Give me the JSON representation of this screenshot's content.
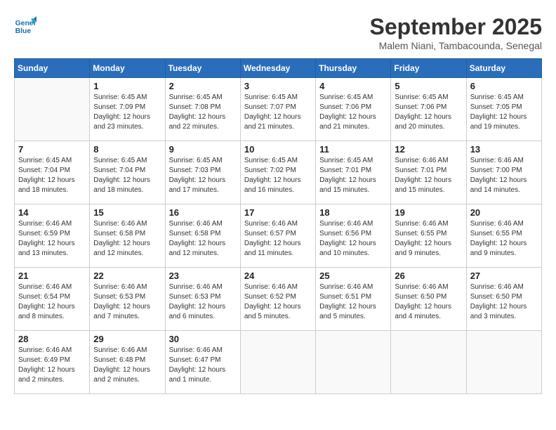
{
  "logo": {
    "line1": "General",
    "line2": "Blue"
  },
  "title": "September 2025",
  "location": "Malem Niani, Tambacounda, Senegal",
  "weekdays": [
    "Sunday",
    "Monday",
    "Tuesday",
    "Wednesday",
    "Thursday",
    "Friday",
    "Saturday"
  ],
  "weeks": [
    [
      {
        "day": "",
        "info": ""
      },
      {
        "day": "1",
        "info": "Sunrise: 6:45 AM\nSunset: 7:09 PM\nDaylight: 12 hours\nand 23 minutes."
      },
      {
        "day": "2",
        "info": "Sunrise: 6:45 AM\nSunset: 7:08 PM\nDaylight: 12 hours\nand 22 minutes."
      },
      {
        "day": "3",
        "info": "Sunrise: 6:45 AM\nSunset: 7:07 PM\nDaylight: 12 hours\nand 21 minutes."
      },
      {
        "day": "4",
        "info": "Sunrise: 6:45 AM\nSunset: 7:06 PM\nDaylight: 12 hours\nand 21 minutes."
      },
      {
        "day": "5",
        "info": "Sunrise: 6:45 AM\nSunset: 7:06 PM\nDaylight: 12 hours\nand 20 minutes."
      },
      {
        "day": "6",
        "info": "Sunrise: 6:45 AM\nSunset: 7:05 PM\nDaylight: 12 hours\nand 19 minutes."
      }
    ],
    [
      {
        "day": "7",
        "info": "Sunrise: 6:45 AM\nSunset: 7:04 PM\nDaylight: 12 hours\nand 18 minutes."
      },
      {
        "day": "8",
        "info": "Sunrise: 6:45 AM\nSunset: 7:04 PM\nDaylight: 12 hours\nand 18 minutes."
      },
      {
        "day": "9",
        "info": "Sunrise: 6:45 AM\nSunset: 7:03 PM\nDaylight: 12 hours\nand 17 minutes."
      },
      {
        "day": "10",
        "info": "Sunrise: 6:45 AM\nSunset: 7:02 PM\nDaylight: 12 hours\nand 16 minutes."
      },
      {
        "day": "11",
        "info": "Sunrise: 6:45 AM\nSunset: 7:01 PM\nDaylight: 12 hours\nand 15 minutes."
      },
      {
        "day": "12",
        "info": "Sunrise: 6:46 AM\nSunset: 7:01 PM\nDaylight: 12 hours\nand 15 minutes."
      },
      {
        "day": "13",
        "info": "Sunrise: 6:46 AM\nSunset: 7:00 PM\nDaylight: 12 hours\nand 14 minutes."
      }
    ],
    [
      {
        "day": "14",
        "info": "Sunrise: 6:46 AM\nSunset: 6:59 PM\nDaylight: 12 hours\nand 13 minutes."
      },
      {
        "day": "15",
        "info": "Sunrise: 6:46 AM\nSunset: 6:58 PM\nDaylight: 12 hours\nand 12 minutes."
      },
      {
        "day": "16",
        "info": "Sunrise: 6:46 AM\nSunset: 6:58 PM\nDaylight: 12 hours\nand 12 minutes."
      },
      {
        "day": "17",
        "info": "Sunrise: 6:46 AM\nSunset: 6:57 PM\nDaylight: 12 hours\nand 11 minutes."
      },
      {
        "day": "18",
        "info": "Sunrise: 6:46 AM\nSunset: 6:56 PM\nDaylight: 12 hours\nand 10 minutes."
      },
      {
        "day": "19",
        "info": "Sunrise: 6:46 AM\nSunset: 6:55 PM\nDaylight: 12 hours\nand 9 minutes."
      },
      {
        "day": "20",
        "info": "Sunrise: 6:46 AM\nSunset: 6:55 PM\nDaylight: 12 hours\nand 9 minutes."
      }
    ],
    [
      {
        "day": "21",
        "info": "Sunrise: 6:46 AM\nSunset: 6:54 PM\nDaylight: 12 hours\nand 8 minutes."
      },
      {
        "day": "22",
        "info": "Sunrise: 6:46 AM\nSunset: 6:53 PM\nDaylight: 12 hours\nand 7 minutes."
      },
      {
        "day": "23",
        "info": "Sunrise: 6:46 AM\nSunset: 6:53 PM\nDaylight: 12 hours\nand 6 minutes."
      },
      {
        "day": "24",
        "info": "Sunrise: 6:46 AM\nSunset: 6:52 PM\nDaylight: 12 hours\nand 5 minutes."
      },
      {
        "day": "25",
        "info": "Sunrise: 6:46 AM\nSunset: 6:51 PM\nDaylight: 12 hours\nand 5 minutes."
      },
      {
        "day": "26",
        "info": "Sunrise: 6:46 AM\nSunset: 6:50 PM\nDaylight: 12 hours\nand 4 minutes."
      },
      {
        "day": "27",
        "info": "Sunrise: 6:46 AM\nSunset: 6:50 PM\nDaylight: 12 hours\nand 3 minutes."
      }
    ],
    [
      {
        "day": "28",
        "info": "Sunrise: 6:46 AM\nSunset: 6:49 PM\nDaylight: 12 hours\nand 2 minutes."
      },
      {
        "day": "29",
        "info": "Sunrise: 6:46 AM\nSunset: 6:48 PM\nDaylight: 12 hours\nand 2 minutes."
      },
      {
        "day": "30",
        "info": "Sunrise: 6:46 AM\nSunset: 6:47 PM\nDaylight: 12 hours\nand 1 minute."
      },
      {
        "day": "",
        "info": ""
      },
      {
        "day": "",
        "info": ""
      },
      {
        "day": "",
        "info": ""
      },
      {
        "day": "",
        "info": ""
      }
    ]
  ]
}
